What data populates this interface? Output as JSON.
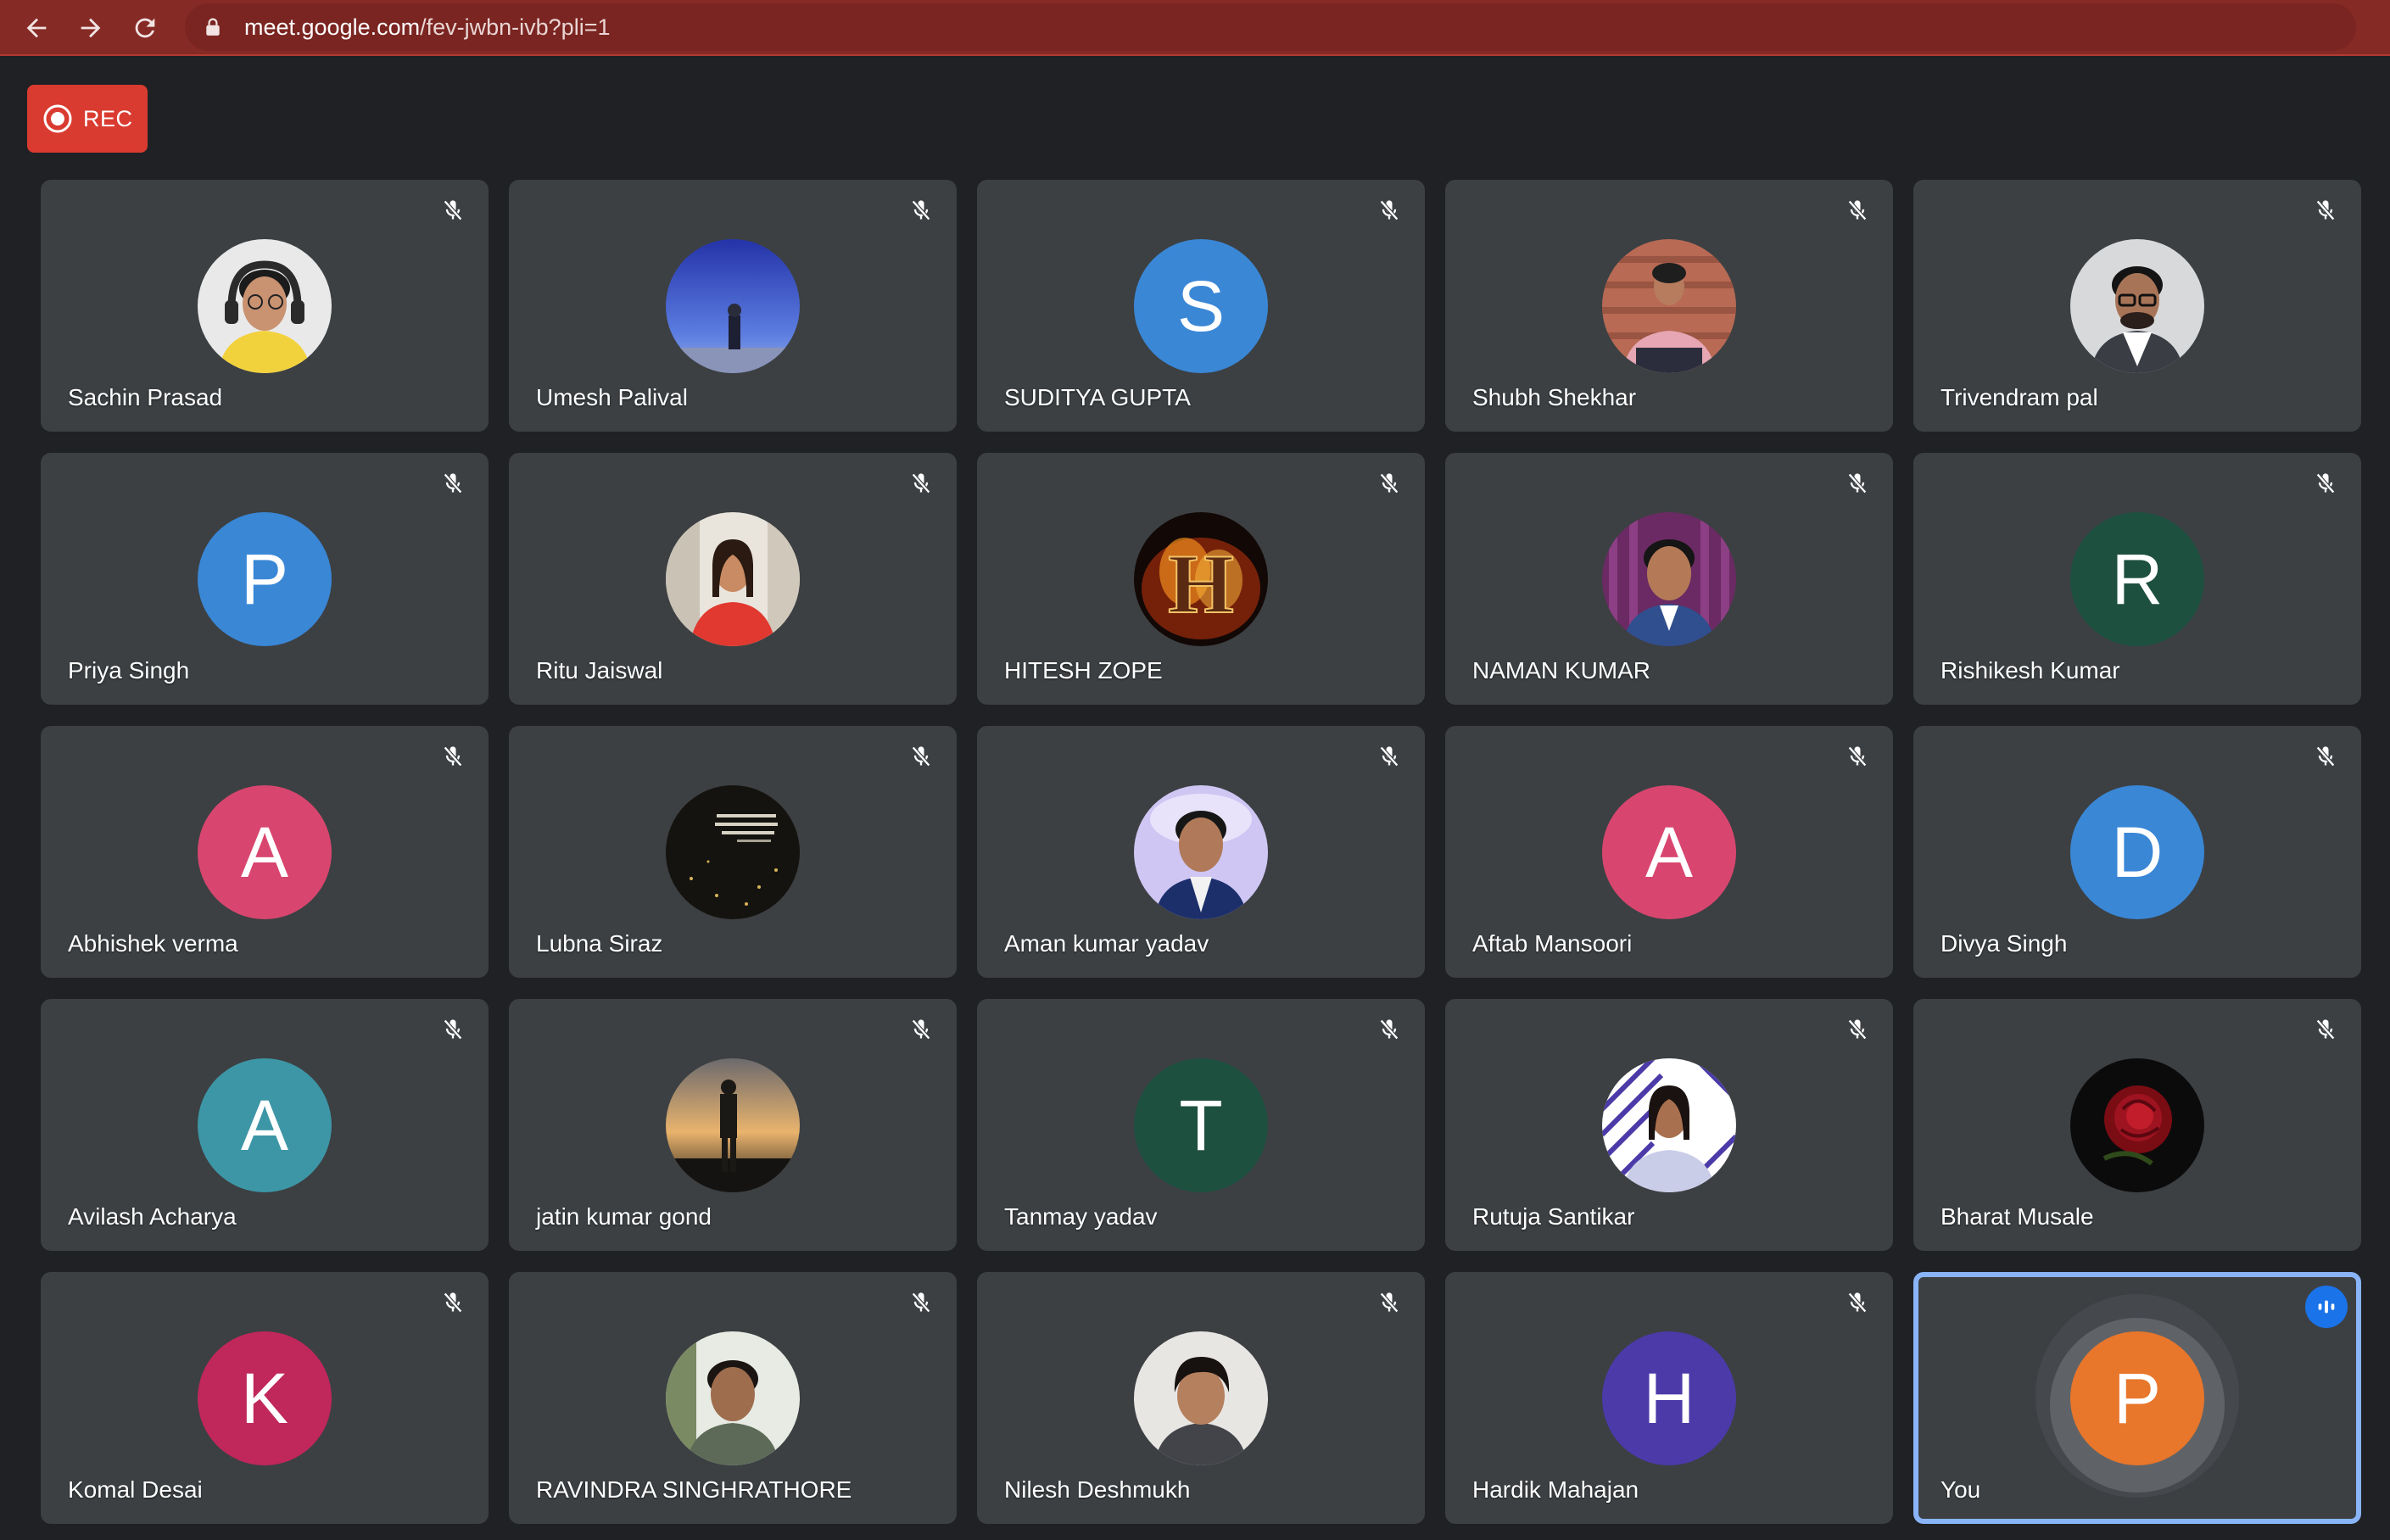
{
  "browser": {
    "url_domain": "meet.google.com",
    "url_path": "/fev-jwbn-ivb?pli=1"
  },
  "rec": {
    "label": "REC"
  },
  "colors": {
    "browser_bar": "#862a25",
    "rec_button": "#d93b30",
    "tile_bg": "#3c4043",
    "page_bg": "#202124",
    "active_border": "#8ab4f8"
  },
  "participants": [
    {
      "name": "Sachin Prasad",
      "avatar_type": "photo",
      "photo": "person-headset"
    },
    {
      "name": "Umesh Palival",
      "avatar_type": "photo",
      "photo": "person-sky"
    },
    {
      "name": "SUDITYA GUPTA",
      "avatar_type": "initial",
      "initial": "S",
      "color": "#3a87d6"
    },
    {
      "name": "Shubh Shekhar",
      "avatar_type": "photo",
      "photo": "person-steps"
    },
    {
      "name": "Trivendram pal",
      "avatar_type": "photo",
      "photo": "person-glasses"
    },
    {
      "name": "Priya Singh",
      "avatar_type": "initial",
      "initial": "P",
      "color": "#3a87d6"
    },
    {
      "name": "Ritu Jaiswal",
      "avatar_type": "photo",
      "photo": "person-red-dress"
    },
    {
      "name": "HITESH ZOPE",
      "avatar_type": "photo",
      "photo": "fire-letter-h"
    },
    {
      "name": "NAMAN KUMAR",
      "avatar_type": "photo",
      "photo": "person-suit-curtain"
    },
    {
      "name": "Rishikesh Kumar",
      "avatar_type": "initial",
      "initial": "R",
      "color": "#1e5040"
    },
    {
      "name": "Abhishek verma",
      "avatar_type": "initial",
      "initial": "A",
      "color": "#d8466f"
    },
    {
      "name": "Lubna Siraz",
      "avatar_type": "photo",
      "photo": "dark-text-quote"
    },
    {
      "name": "Aman kumar yadav",
      "avatar_type": "photo",
      "photo": "person-purple-bg"
    },
    {
      "name": "Aftab Mansoori",
      "avatar_type": "initial",
      "initial": "A",
      "color": "#d8466f"
    },
    {
      "name": "Divya Singh",
      "avatar_type": "initial",
      "initial": "D",
      "color": "#3a87d6"
    },
    {
      "name": "Avilash Acharya",
      "avatar_type": "initial",
      "initial": "A",
      "color": "#3d96a6"
    },
    {
      "name": "jatin kumar gond",
      "avatar_type": "photo",
      "photo": "silhouette-sunset"
    },
    {
      "name": "Tanmay yadav",
      "avatar_type": "initial",
      "initial": "T",
      "color": "#1e5040"
    },
    {
      "name": "Rutuja Santikar",
      "avatar_type": "photo",
      "photo": "person-stripes"
    },
    {
      "name": "Bharat Musale",
      "avatar_type": "photo",
      "photo": "red-rose"
    },
    {
      "name": "Komal Desai",
      "avatar_type": "initial",
      "initial": "K",
      "color": "#c0275a"
    },
    {
      "name": "RAVINDRA SINGHRATHORE",
      "avatar_type": "photo",
      "photo": "person-selfie"
    },
    {
      "name": "Nilesh Deshmukh",
      "avatar_type": "photo",
      "photo": "person-portrait"
    },
    {
      "name": "Hardik Mahajan",
      "avatar_type": "initial",
      "initial": "H",
      "color": "#4b3aa8"
    },
    {
      "name": "You",
      "avatar_type": "initial",
      "initial": "P",
      "color": "#e8762b",
      "is_self": true,
      "speaking": true
    }
  ]
}
